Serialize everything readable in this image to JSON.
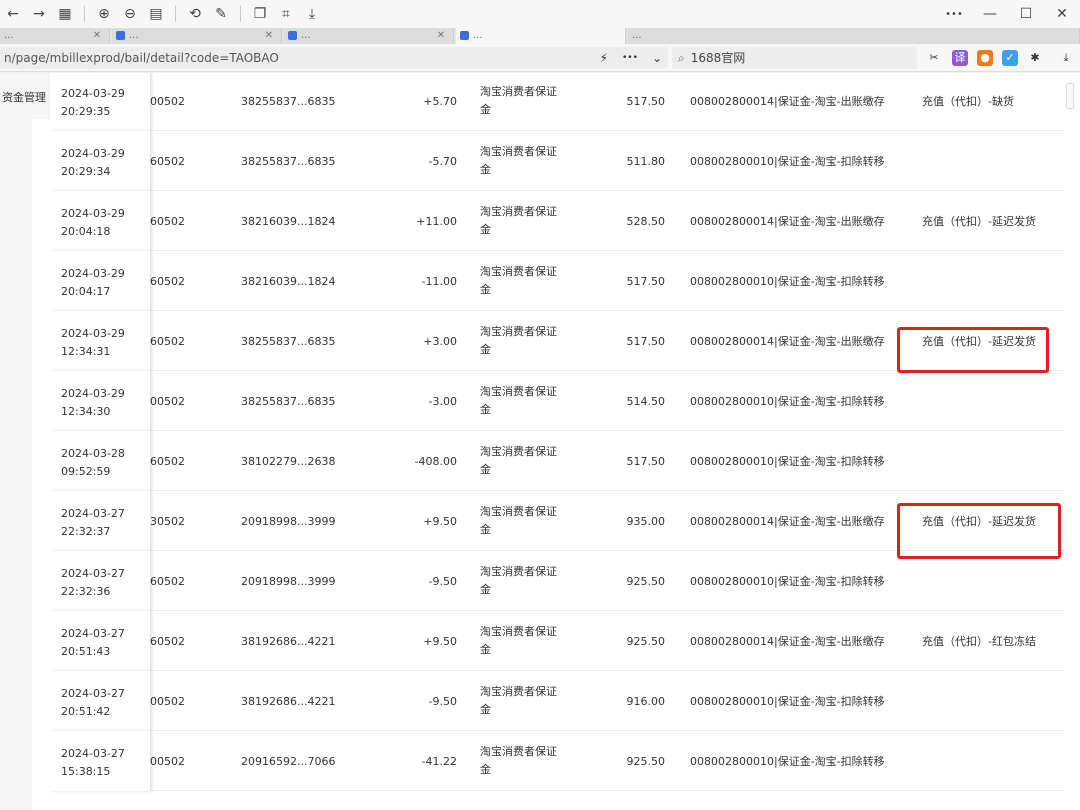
{
  "toolbar": {
    "buttons": [
      "back-icon",
      "forward-icon",
      "grid-icon",
      "zoom-in-icon",
      "zoom-out-icon",
      "reader-icon",
      "rotate-icon",
      "edit-icon",
      "copy-icon",
      "screenshot-icon",
      "download-icon"
    ],
    "back": "←",
    "forward": "→",
    "apps": "▦",
    "zoom_in": "⊕",
    "zoom_out": "⊖",
    "reader": "▤",
    "rotate": "⟲",
    "edit": "✎",
    "copy": "❐",
    "capture": "⌗",
    "save": "⤓",
    "more": "•••",
    "minimize": "—",
    "maximize": "☐",
    "close": "✕"
  },
  "tabs": [
    {
      "label": "...",
      "active": false
    },
    {
      "label": "...",
      "active": false
    },
    {
      "label": "...",
      "active": false
    },
    {
      "label": "...",
      "active": true
    },
    {
      "label": "...",
      "active": false
    }
  ],
  "address": {
    "url": "n/page/mbillexprod/bail/detail?code=TAOBAO",
    "bolt": "⚡",
    "dots": "•••",
    "chevron": "⌄",
    "search_text": "1688官网",
    "search_icon": "⌕"
  },
  "extensions": {
    "scissors": "✂",
    "ext2": "译",
    "ext3": "●",
    "ext4": "✓",
    "puzzle": "✱",
    "download": "⤓"
  },
  "sidebar": {
    "label": "资金管理"
  },
  "rows": [
    {
      "date": "2024-03-29",
      "time": "20:29:35",
      "acct": "00502",
      "order": "38255837...6835",
      "amount": "+5.70",
      "type": "淘宝消费者保证金",
      "balance": "517.50",
      "subject": "008002800014|保证金-淘宝-出账缴存",
      "note": "充值（代扣）-缺货"
    },
    {
      "date": "2024-03-29",
      "time": "20:29:34",
      "acct": "60502",
      "order": "38255837...6835",
      "amount": "-5.70",
      "type": "淘宝消费者保证金",
      "balance": "511.80",
      "subject": "008002800010|保证金-淘宝-扣除转移",
      "note": ""
    },
    {
      "date": "2024-03-29",
      "time": "20:04:18",
      "acct": "60502",
      "order": "38216039...1824",
      "amount": "+11.00",
      "type": "淘宝消费者保证金",
      "balance": "528.50",
      "subject": "008002800014|保证金-淘宝-出账缴存",
      "note": "充值（代扣）-延迟发货"
    },
    {
      "date": "2024-03-29",
      "time": "20:04:17",
      "acct": "60502",
      "order": "38216039...1824",
      "amount": "-11.00",
      "type": "淘宝消费者保证金",
      "balance": "517.50",
      "subject": "008002800010|保证金-淘宝-扣除转移",
      "note": ""
    },
    {
      "date": "2024-03-29",
      "time": "12:34:31",
      "acct": "60502",
      "order": "38255837...6835",
      "amount": "+3.00",
      "type": "淘宝消费者保证金",
      "balance": "517.50",
      "subject": "008002800014|保证金-淘宝-出账缴存",
      "note": "充值（代扣）-延迟发货"
    },
    {
      "date": "2024-03-29",
      "time": "12:34:30",
      "acct": "00502",
      "order": "38255837...6835",
      "amount": "-3.00",
      "type": "淘宝消费者保证金",
      "balance": "514.50",
      "subject": "008002800010|保证金-淘宝-扣除转移",
      "note": ""
    },
    {
      "date": "2024-03-28",
      "time": "09:52:59",
      "acct": "60502",
      "order": "38102279...2638",
      "amount": "-408.00",
      "type": "淘宝消费者保证金",
      "balance": "517.50",
      "subject": "008002800010|保证金-淘宝-扣除转移",
      "note": ""
    },
    {
      "date": "2024-03-27",
      "time": "22:32:37",
      "acct": "30502",
      "order": "20918998...3999",
      "amount": "+9.50",
      "type": "淘宝消费者保证金",
      "balance": "935.00",
      "subject": "008002800014|保证金-淘宝-出账缴存",
      "note": "充值（代扣）-延迟发货"
    },
    {
      "date": "2024-03-27",
      "time": "22:32:36",
      "acct": "60502",
      "order": "20918998...3999",
      "amount": "-9.50",
      "type": "淘宝消费者保证金",
      "balance": "925.50",
      "subject": "008002800010|保证金-淘宝-扣除转移",
      "note": ""
    },
    {
      "date": "2024-03-27",
      "time": "20:51:43",
      "acct": "60502",
      "order": "38192686...4221",
      "amount": "+9.50",
      "type": "淘宝消费者保证金",
      "balance": "925.50",
      "subject": "008002800014|保证金-淘宝-出账缴存",
      "note": "充值（代扣）-红包冻结"
    },
    {
      "date": "2024-03-27",
      "time": "20:51:42",
      "acct": "00502",
      "order": "38192686...4221",
      "amount": "-9.50",
      "type": "淘宝消费者保证金",
      "balance": "916.00",
      "subject": "008002800010|保证金-淘宝-扣除转移",
      "note": ""
    },
    {
      "date": "2024-03-27",
      "time": "15:38:15",
      "acct": "00502",
      "order": "20916592...7066",
      "amount": "-41.22",
      "type": "淘宝消费者保证金",
      "balance": "925.50",
      "subject": "008002800010|保证金-淘宝-扣除转移",
      "note": ""
    }
  ],
  "annotation_color": "#e0201a"
}
